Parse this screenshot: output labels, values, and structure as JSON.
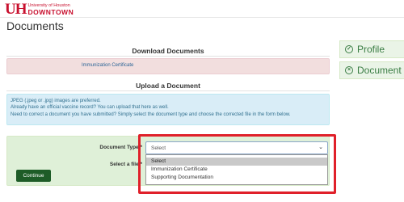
{
  "header": {
    "logo_mark": "UH",
    "logo_univ": "University of Houston",
    "logo_campus": "DOWNTOWN"
  },
  "page": {
    "title": "Documents"
  },
  "download": {
    "heading": "Download Documents",
    "link": "Immunization Certificate"
  },
  "upload": {
    "heading": "Upload a Document",
    "info_lines": [
      "JPEG (.jpeg or .jpg) images are preferred.",
      "Already have an official vaccine record? You can upload that here as well.",
      "Need to correct a document you have submitted? Simply select the document type and choose the corrected file in the form below."
    ],
    "doc_type_label": "Document Type *",
    "file_label": "Select a file *",
    "continue_label": "Continue",
    "select": {
      "value": "Select",
      "options": [
        "Select",
        "Immunization Certificate",
        "Supporting Documentation"
      ],
      "selected_index": 0
    }
  },
  "sidebar": {
    "items": [
      {
        "label": "Profile",
        "icon": "check-circle-icon"
      },
      {
        "label": "Document",
        "icon": "close-circle-icon"
      }
    ]
  },
  "colors": {
    "brand_red": "#c8102e",
    "sidebar_green": "#3a7d44",
    "highlight_red": "#e0202a",
    "button_green": "#1e5c27"
  }
}
